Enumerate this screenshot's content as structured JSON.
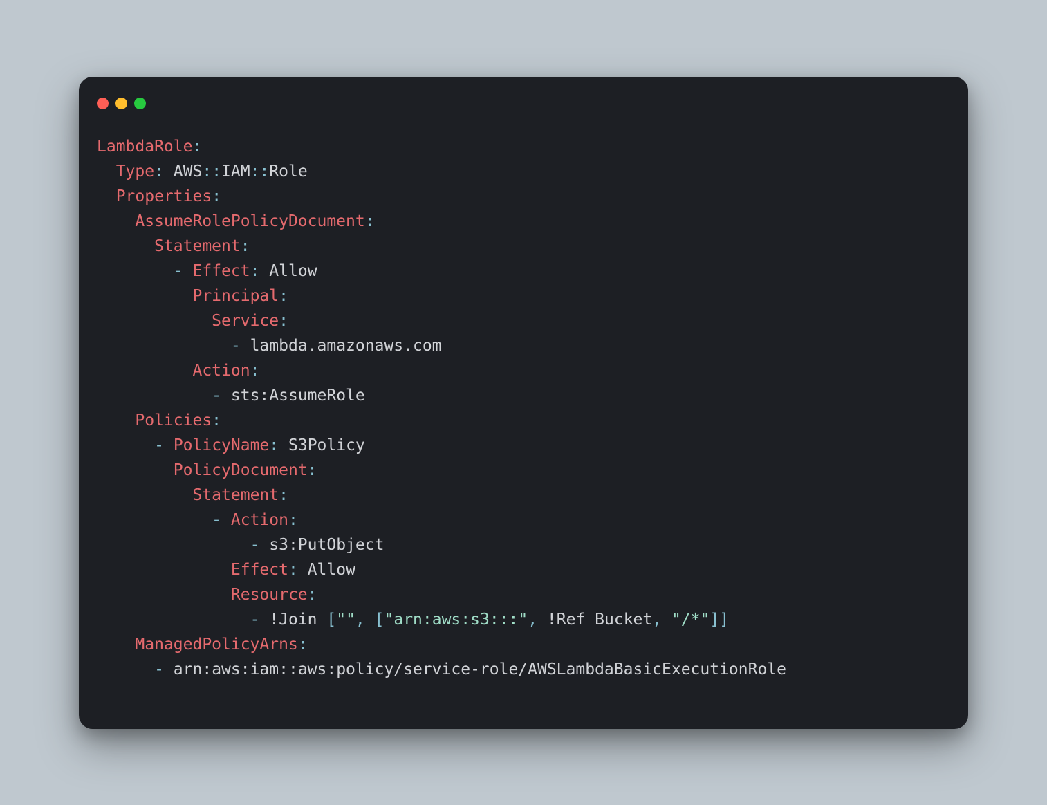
{
  "code": {
    "lines": [
      [
        [
          "k",
          "LambdaRole"
        ],
        [
          "p",
          ":"
        ]
      ],
      [
        [
          "v",
          "  "
        ],
        [
          "k",
          "Type"
        ],
        [
          "p",
          ":"
        ],
        [
          "v",
          " AWS"
        ],
        [
          "p",
          "::"
        ],
        [
          "v",
          "IAM"
        ],
        [
          "p",
          "::"
        ],
        [
          "v",
          "Role"
        ]
      ],
      [
        [
          "v",
          "  "
        ],
        [
          "k",
          "Properties"
        ],
        [
          "p",
          ":"
        ]
      ],
      [
        [
          "v",
          "    "
        ],
        [
          "k",
          "AssumeRolePolicyDocument"
        ],
        [
          "p",
          ":"
        ]
      ],
      [
        [
          "v",
          "      "
        ],
        [
          "k",
          "Statement"
        ],
        [
          "p",
          ":"
        ]
      ],
      [
        [
          "v",
          "        "
        ],
        [
          "p",
          "-"
        ],
        [
          "v",
          " "
        ],
        [
          "k",
          "Effect"
        ],
        [
          "p",
          ":"
        ],
        [
          "v",
          " Allow"
        ]
      ],
      [
        [
          "v",
          "          "
        ],
        [
          "k",
          "Principal"
        ],
        [
          "p",
          ":"
        ]
      ],
      [
        [
          "v",
          "            "
        ],
        [
          "k",
          "Service"
        ],
        [
          "p",
          ":"
        ]
      ],
      [
        [
          "v",
          "              "
        ],
        [
          "p",
          "-"
        ],
        [
          "v",
          " lambda.amazonaws.com"
        ]
      ],
      [
        [
          "v",
          "          "
        ],
        [
          "k",
          "Action"
        ],
        [
          "p",
          ":"
        ]
      ],
      [
        [
          "v",
          "            "
        ],
        [
          "p",
          "-"
        ],
        [
          "v",
          " sts:AssumeRole"
        ]
      ],
      [
        [
          "v",
          "    "
        ],
        [
          "k",
          "Policies"
        ],
        [
          "p",
          ":"
        ]
      ],
      [
        [
          "v",
          "      "
        ],
        [
          "p",
          "-"
        ],
        [
          "v",
          " "
        ],
        [
          "k",
          "PolicyName"
        ],
        [
          "p",
          ":"
        ],
        [
          "v",
          " S3Policy"
        ]
      ],
      [
        [
          "v",
          "        "
        ],
        [
          "k",
          "PolicyDocument"
        ],
        [
          "p",
          ":"
        ]
      ],
      [
        [
          "v",
          "          "
        ],
        [
          "k",
          "Statement"
        ],
        [
          "p",
          ":"
        ]
      ],
      [
        [
          "v",
          "            "
        ],
        [
          "p",
          "-"
        ],
        [
          "v",
          " "
        ],
        [
          "k",
          "Action"
        ],
        [
          "p",
          ":"
        ]
      ],
      [
        [
          "v",
          "                "
        ],
        [
          "p",
          "-"
        ],
        [
          "v",
          " s3:PutObject"
        ]
      ],
      [
        [
          "v",
          "              "
        ],
        [
          "k",
          "Effect"
        ],
        [
          "p",
          ":"
        ],
        [
          "v",
          " Allow"
        ]
      ],
      [
        [
          "v",
          "              "
        ],
        [
          "k",
          "Resource"
        ],
        [
          "p",
          ":"
        ]
      ],
      [
        [
          "v",
          "                "
        ],
        [
          "p",
          "-"
        ],
        [
          "v",
          " !Join "
        ],
        [
          "p",
          "["
        ],
        [
          "s",
          "\"\""
        ],
        [
          "p",
          ","
        ],
        [
          "v",
          " "
        ],
        [
          "p",
          "["
        ],
        [
          "s",
          "\"arn:aws:s3:::\""
        ],
        [
          "p",
          ","
        ],
        [
          "v",
          " !Ref Bucket"
        ],
        [
          "p",
          ","
        ],
        [
          "v",
          " "
        ],
        [
          "s",
          "\"/*\""
        ],
        [
          "p",
          "]]"
        ]
      ],
      [
        [
          "v",
          "    "
        ],
        [
          "k",
          "ManagedPolicyArns"
        ],
        [
          "p",
          ":"
        ]
      ],
      [
        [
          "v",
          "      "
        ],
        [
          "p",
          "-"
        ],
        [
          "v",
          " arn:aws:iam::aws:policy/service-role/AWSLambdaBasicExecutionRole"
        ]
      ]
    ]
  }
}
